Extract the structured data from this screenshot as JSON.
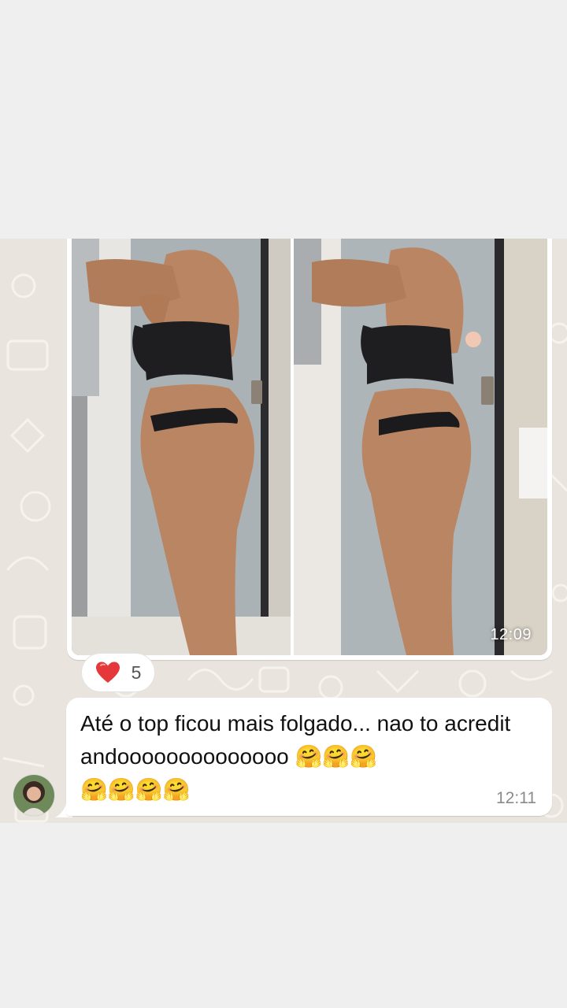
{
  "image_message": {
    "time": "12:09",
    "photo_icon": "before-after-body-photo"
  },
  "reaction": {
    "emoji_icon": "heart-icon",
    "count": "5"
  },
  "text_message": {
    "text": "Até o top ficou mais folgado... nao to acreditandoooooooooooooo 🤗🤗🤗\n🤗🤗🤗🤗",
    "time": "12:11"
  },
  "colors": {
    "chat_background": "#e9e4dd",
    "bubble": "#ffffff",
    "page_background": "#efefef",
    "heart": "#e5383b"
  }
}
